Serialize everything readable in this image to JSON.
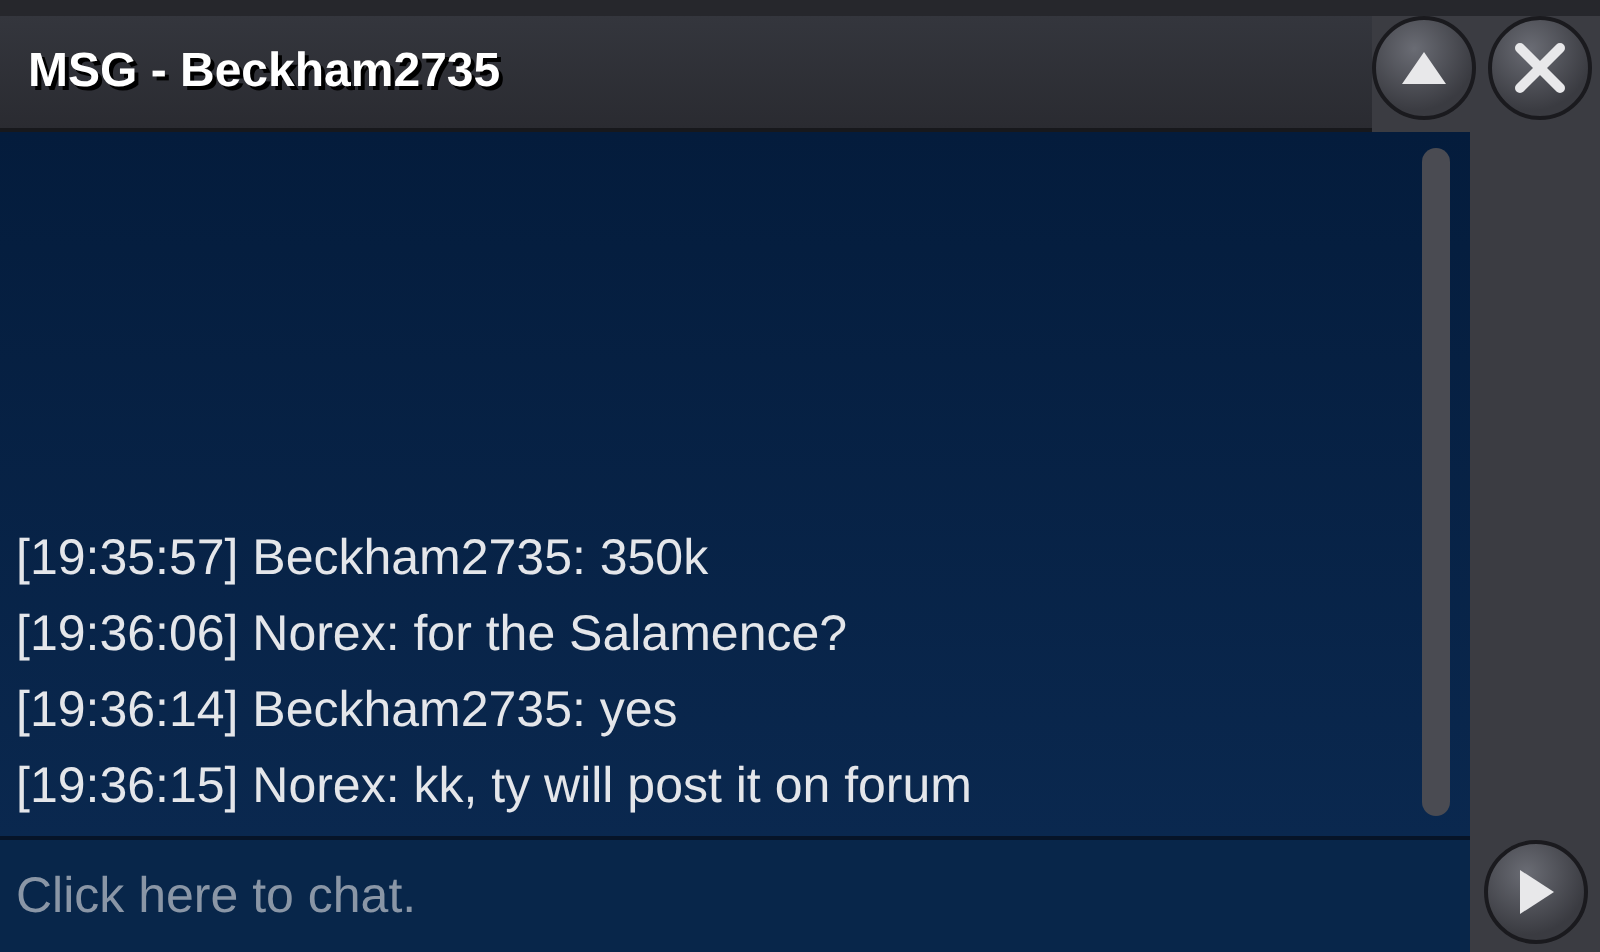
{
  "window": {
    "title": "MSG - Beckham2735"
  },
  "messages": [
    {
      "text": "[19:35:57] Beckham2735: 350k"
    },
    {
      "text": "[19:36:06] Norex: for the Salamence?"
    },
    {
      "text": "[19:36:14] Beckham2735: yes"
    },
    {
      "text": "[19:36:15] Norex: kk, ty will post it on forum"
    }
  ],
  "chat_input": {
    "placeholder": "Click here to chat."
  }
}
